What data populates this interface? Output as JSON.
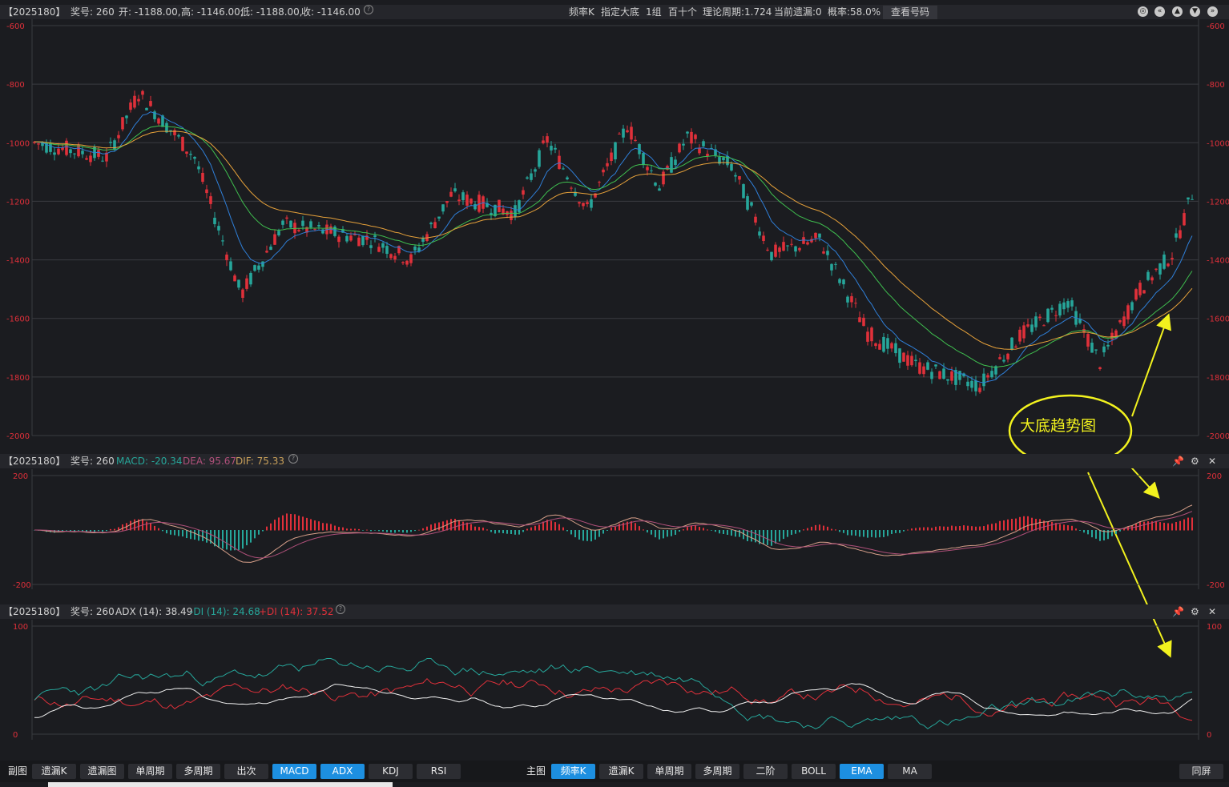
{
  "header": {
    "code": "【2025180】",
    "prize_label": "奖号: 260",
    "open": "开: -1188.00,",
    "high": "高: -1146.00,",
    "low": "低: -1188.00,",
    "close": "收: -1146.00",
    "center": [
      "频率K",
      "指定大底",
      "1组",
      "百十个",
      "理论周期:1.724",
      "当前遗漏:0",
      "概率:58.0%"
    ],
    "view_button": "查看号码"
  },
  "main_chart": {
    "y_ticks": [
      "-600",
      "-800",
      "-1000",
      "-1200",
      "-1400",
      "-1600",
      "-1800",
      "-2000"
    ],
    "annotation": "大底趋势图",
    "colors": {
      "up": "#e0303a",
      "down": "#26a69a",
      "ema_short": "#2f7fd8",
      "ema_mid": "#3fbf4f",
      "ema_long": "#e6a13a"
    }
  },
  "macd_panel": {
    "code": "【2025180】",
    "prize_label": "奖号: 260",
    "macd": "MACD: -20.34",
    "dea": "DEA: 95.67",
    "dif": "DIF: 75.33",
    "y_ticks": [
      "200",
      "-200"
    ]
  },
  "adx_panel": {
    "code": "【2025180】",
    "prize_label": "奖号: 260",
    "adx": "ADX (14): 38.49",
    "minus_di": "-DI (14): 24.68",
    "plus_di": "+DI (14): 37.52",
    "y_ticks": [
      "100",
      "0"
    ]
  },
  "bottom_bar": {
    "left_label": "副图",
    "left_buttons": [
      "遗漏K",
      "遗漏图",
      "单周期",
      "多周期",
      "出次",
      "MACD",
      "ADX",
      "KDJ",
      "RSI"
    ],
    "left_active": [
      "MACD",
      "ADX"
    ],
    "main_label": "主图",
    "main_buttons": [
      "频率K",
      "遗漏K",
      "单周期",
      "多周期",
      "二阶",
      "BOLL",
      "EMA",
      "MA"
    ],
    "main_active": [
      "频率K",
      "EMA"
    ],
    "right_button": "同屏"
  }
}
